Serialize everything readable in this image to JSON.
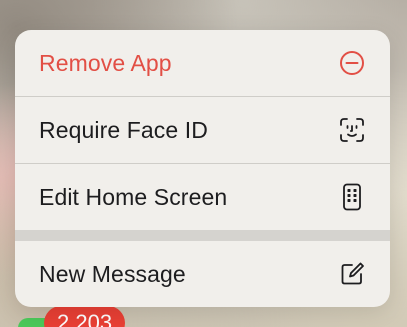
{
  "menu": {
    "items": [
      {
        "label": "Remove App",
        "icon": "minus-circle-icon",
        "destructive": true
      },
      {
        "label": "Require Face ID",
        "icon": "face-id-icon",
        "destructive": false
      },
      {
        "label": "Edit Home Screen",
        "icon": "home-screen-phone-icon",
        "destructive": false
      },
      {
        "label": "New Message",
        "icon": "compose-icon",
        "destructive": false
      }
    ]
  },
  "badge": {
    "count": "2,203"
  },
  "colors": {
    "destructive": "#e24f45",
    "label": "#1d1d1f",
    "menu_background": "#f1efeb",
    "badge": "#ea4035"
  }
}
